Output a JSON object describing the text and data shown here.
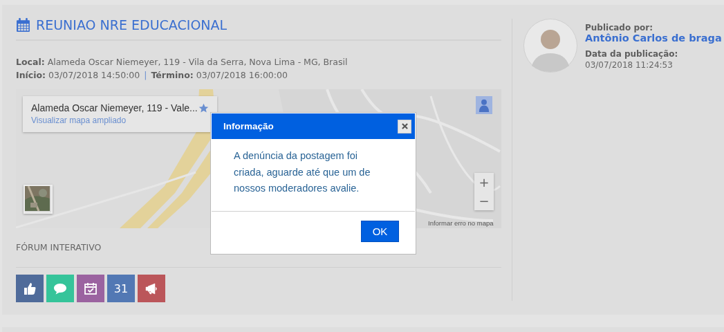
{
  "event": {
    "title": "REUNIAO NRE EDUCACIONAL",
    "details": [
      {
        "label": "Local:",
        "value": "Alameda Oscar Niemeyer, 119 - Vila da Serra, Nova Lima - MG, Brasil"
      },
      {
        "label": "Início:",
        "value": "03/07/2018 14:50:00",
        "separator": "|",
        "label2": "Término:",
        "value2": "03/07/2018 16:00:00"
      }
    ]
  },
  "map": {
    "place_title": "Alameda Oscar Niemeyer, 119 - Vale...",
    "place_link": "Visualizar mapa ampliado",
    "zoom_in": "+",
    "zoom_out": "−",
    "report_link": "Informar erro no mapa"
  },
  "forum": {
    "title": "FÓRUM INTERATIVO",
    "actions": [
      {
        "kind": "like",
        "color": "#4f6b9a"
      },
      {
        "kind": "comment",
        "color": "#35c49a"
      },
      {
        "kind": "calendar",
        "color": "#9b63a0"
      },
      {
        "kind": "count",
        "label": "31",
        "color": "#5278b4"
      },
      {
        "kind": "announce",
        "color": "#bb565a"
      }
    ]
  },
  "author": {
    "published_by_label": "Publicado por:",
    "name": "Antônio Carlos de braga",
    "date_label": "Data da publicação:",
    "date": "03/07/2018 11:24:53"
  },
  "dialog": {
    "title": "Informação",
    "message": "A denúncia da postagem foi criada, aguarde até que um de nossos moderadores avalie.",
    "ok": "OK"
  }
}
